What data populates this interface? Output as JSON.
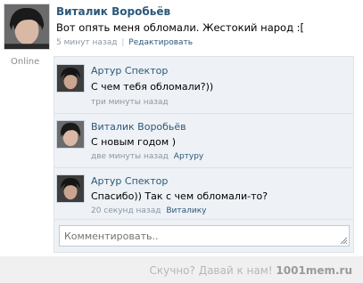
{
  "post": {
    "author": "Виталик Воробьёв",
    "online_label": "Online",
    "text": "Вот опять меня обломали. Жестокий народ :[",
    "time": "5 минут назад",
    "separator": "|",
    "edit_label": "Редактировать"
  },
  "replies": [
    {
      "author": "Артур Спектор",
      "text": "С чем тебя обломали?))",
      "meta": "три минуты назад",
      "reply_to": ""
    },
    {
      "author": "Виталик Воробьёв",
      "text": "С новым годом )",
      "meta": "две минуты назад",
      "reply_to": "Артуру"
    },
    {
      "author": "Артур Спектор",
      "text": "Спасибо)) Так с чем обломали-то?",
      "meta": "20 секунд назад",
      "reply_to": "Виталику"
    }
  ],
  "comment_input": {
    "placeholder": "Комментировать.."
  },
  "footer": {
    "text": "Скучно? Давай к нам!",
    "brand": "1001mem.ru"
  },
  "colors": {
    "link": "#2b587a",
    "meta": "#8b97a5",
    "reply_background": "#eef1f5"
  }
}
